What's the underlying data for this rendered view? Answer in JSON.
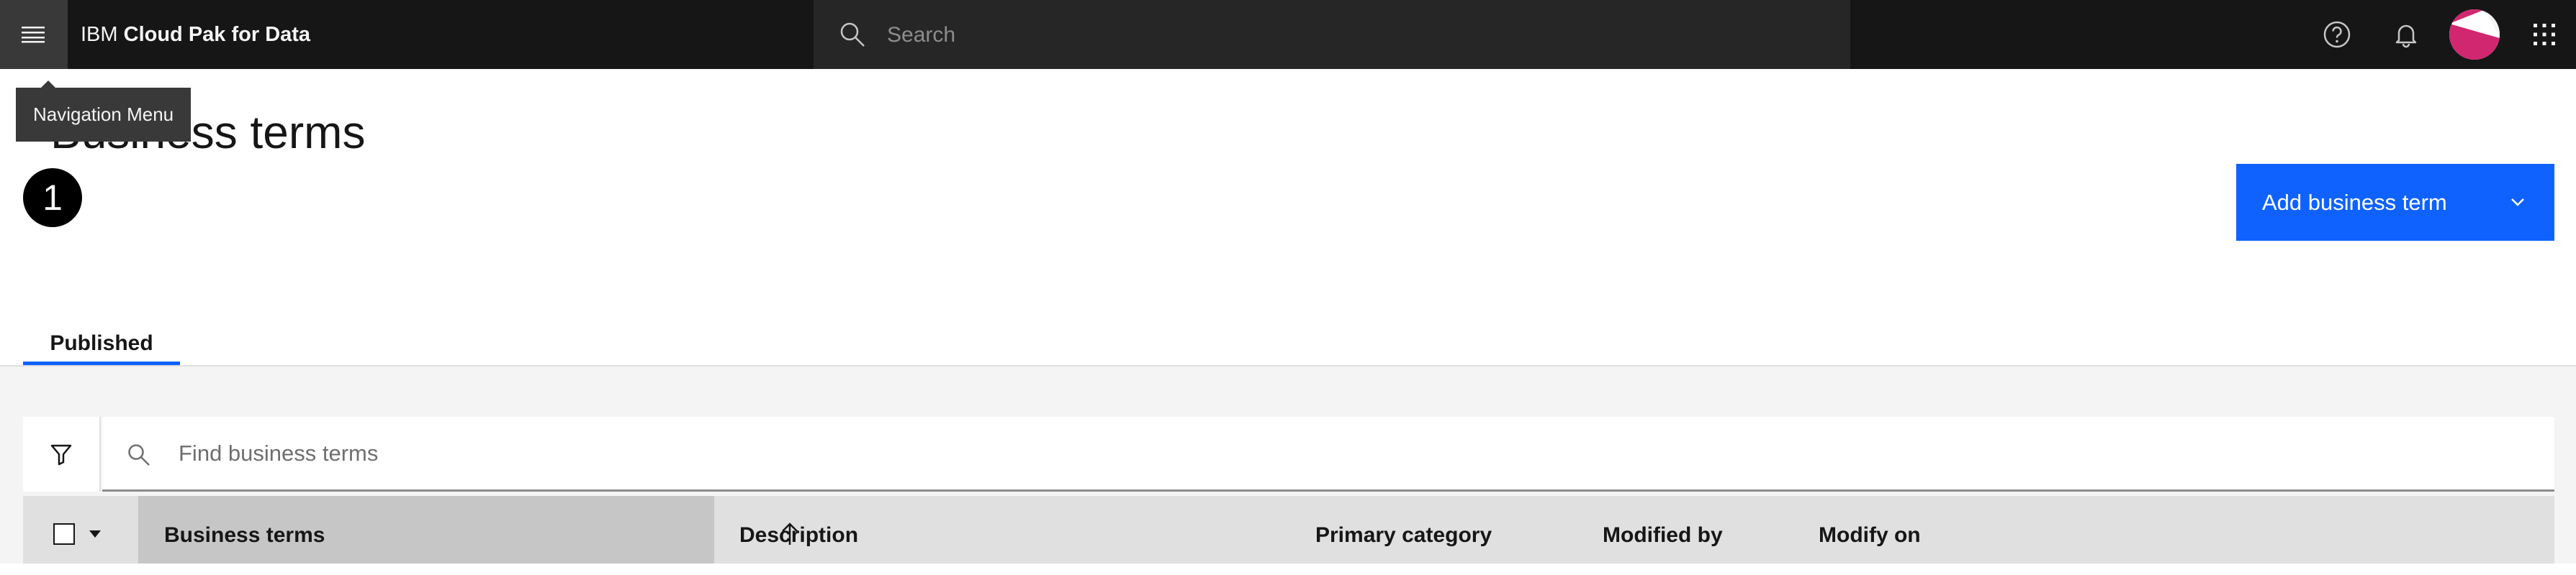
{
  "header": {
    "brand_prefix": "IBM",
    "brand_product": "Cloud Pak for Data",
    "search_placeholder": "Search",
    "icons": [
      "menu-icon",
      "search-icon",
      "help-icon",
      "notification-icon",
      "avatar",
      "app-switcher-icon"
    ]
  },
  "tooltip": {
    "text": "Navigation Menu"
  },
  "page": {
    "title": "Business terms",
    "step_badge": "1",
    "add_button_label": "Add business term"
  },
  "tabs": [
    {
      "label": "Published",
      "selected": true
    }
  ],
  "toolbar": {
    "find_placeholder": "Find business terms"
  },
  "table": {
    "columns": [
      "Business terms",
      "Description",
      "Primary category",
      "Modified by",
      "Modify on"
    ],
    "sorted_column": "Business terms",
    "sort_direction": "ascending"
  },
  "colors": {
    "header_bg": "#161616",
    "accent": "#0f62fe",
    "avatar_primary": "#d12771"
  }
}
